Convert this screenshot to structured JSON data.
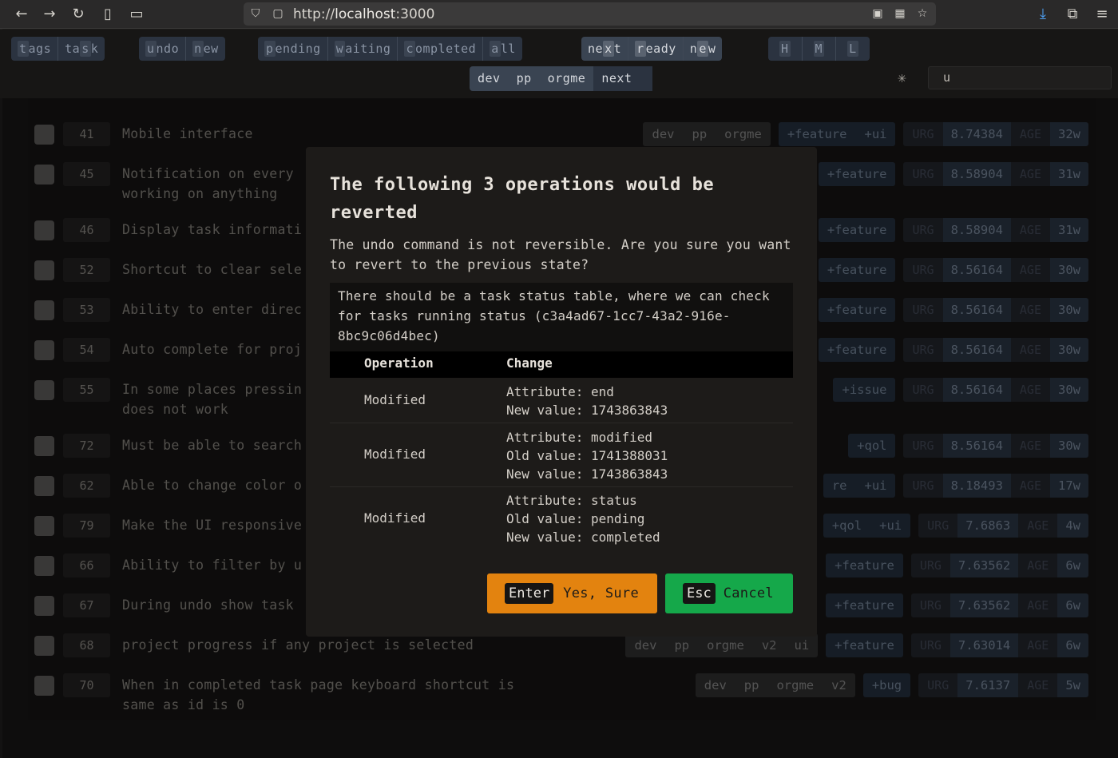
{
  "browser": {
    "url_prefix": "http://",
    "url_host": "localhost",
    "url_port": ":3000"
  },
  "toolbar": {
    "groups": [
      {
        "segments": [
          {
            "pre": "",
            "key": "t",
            "post": "ags"
          },
          {
            "pre": "ta",
            "key": "s",
            "post": "k"
          }
        ]
      },
      {
        "segments": [
          {
            "pre": "",
            "key": "u",
            "post": "ndo"
          },
          {
            "pre": "",
            "key": "n",
            "post": "ew"
          }
        ]
      },
      {
        "segments": [
          {
            "pre": "",
            "key": "p",
            "post": "ending"
          },
          {
            "pre": "",
            "key": "w",
            "post": "aiting"
          },
          {
            "pre": "",
            "key": "c",
            "post": "ompleted"
          },
          {
            "pre": "",
            "key": "a",
            "post": "ll"
          }
        ]
      },
      {
        "segments": [
          {
            "pre": "ne",
            "key": "x",
            "post": "t"
          },
          {
            "pre": "",
            "key": "r",
            "post": "eady"
          },
          {
            "pre": "n",
            "key": "e",
            "post": "w"
          }
        ]
      },
      {
        "segments": [
          {
            "pre": "",
            "key": "H",
            "post": ""
          },
          {
            "pre": "",
            "key": "M",
            "post": ""
          },
          {
            "pre": "",
            "key": "L",
            "post": ""
          }
        ]
      }
    ],
    "search_value": "u",
    "star_symbol": "✳",
    "project_path": [
      "dev",
      "pp",
      "orgme"
    ],
    "project_next": "next"
  },
  "tasks": [
    {
      "id": "41",
      "desc": "Mobile interface",
      "project": [
        "dev",
        "pp",
        "orgme"
      ],
      "tags": [
        "+feature",
        "+ui"
      ],
      "urg_label": "URG",
      "urg": "8.74384",
      "age_label": "AGE",
      "age": "32w"
    },
    {
      "id": "45",
      "desc": "Notification on every\nworking on anything",
      "project": [],
      "tags": [
        "+feature"
      ],
      "urg_label": "URG",
      "urg": "8.58904",
      "age_label": "AGE",
      "age": "31w"
    },
    {
      "id": "46",
      "desc": "Display task informati",
      "project": [],
      "tags": [
        "+feature"
      ],
      "urg_label": "URG",
      "urg": "8.58904",
      "age_label": "AGE",
      "age": "31w"
    },
    {
      "id": "52",
      "desc": "Shortcut to clear sele",
      "project": [],
      "tags": [
        "+feature"
      ],
      "urg_label": "URG",
      "urg": "8.56164",
      "age_label": "AGE",
      "age": "30w"
    },
    {
      "id": "53",
      "desc": "Ability to enter direc",
      "project": [],
      "tags": [
        "+feature"
      ],
      "urg_label": "URG",
      "urg": "8.56164",
      "age_label": "AGE",
      "age": "30w"
    },
    {
      "id": "54",
      "desc": "Auto complete for proj",
      "project": [],
      "tags": [
        "+feature"
      ],
      "urg_label": "URG",
      "urg": "8.56164",
      "age_label": "AGE",
      "age": "30w"
    },
    {
      "id": "55",
      "desc": "In some places pressin\ndoes not work",
      "project": [],
      "tags": [
        "+issue"
      ],
      "urg_label": "URG",
      "urg": "8.56164",
      "age_label": "AGE",
      "age": "30w"
    },
    {
      "id": "72",
      "desc": "Must be able to search",
      "project": [],
      "tags": [
        "+qol"
      ],
      "urg_label": "URG",
      "urg": "8.56164",
      "age_label": "AGE",
      "age": "30w"
    },
    {
      "id": "62",
      "desc": "Able to change color o",
      "project": [],
      "tags": [
        "re",
        "+ui"
      ],
      "urg_label": "URG",
      "urg": "8.18493",
      "age_label": "AGE",
      "age": "17w"
    },
    {
      "id": "79",
      "desc": "Make the UI responsive",
      "project": [],
      "tags": [
        "+qol",
        "+ui"
      ],
      "urg_label": "URG",
      "urg": "7.6863",
      "age_label": "AGE",
      "age": "4w"
    },
    {
      "id": "66",
      "desc": "Ability to filter by u",
      "project": [],
      "tags": [
        "+feature"
      ],
      "urg_label": "URG",
      "urg": "7.63562",
      "age_label": "AGE",
      "age": "6w"
    },
    {
      "id": "67",
      "desc": "During undo show task",
      "project": [],
      "tags": [
        "+feature"
      ],
      "urg_label": "URG",
      "urg": "7.63562",
      "age_label": "AGE",
      "age": "6w"
    },
    {
      "id": "68",
      "desc": "project progress if any project is selected",
      "project": [
        "dev",
        "pp",
        "orgme",
        "v2",
        "ui"
      ],
      "tags": [
        "+feature"
      ],
      "urg_label": "URG",
      "urg": "7.63014",
      "age_label": "AGE",
      "age": "6w"
    },
    {
      "id": "70",
      "desc": "When in completed task page keyboard shortcut is\nsame as id is 0",
      "project": [
        "dev",
        "pp",
        "orgme",
        "v2"
      ],
      "tags": [
        "+bug"
      ],
      "urg_label": "URG",
      "urg": "7.6137",
      "age_label": "AGE",
      "age": "5w"
    }
  ],
  "modal": {
    "title": "The following 3 operations would be reverted",
    "text": "The undo command is not reversible. Are you sure you want to revert to the previous state?",
    "task_description": "There should be a task status table, where we can check for tasks running status (c3a4ad67-1cc7-43a2-916e-8bc9c06d4bec)",
    "col_operation": "Operation",
    "col_change": "Change",
    "operations": [
      {
        "op": "Modified",
        "change": "Attribute: end\nNew value: 1743863843"
      },
      {
        "op": "Modified",
        "change": "Attribute: modified\nOld value: 1741388031\nNew value: 1743863843"
      },
      {
        "op": "Modified",
        "change": "Attribute: status\nOld value: pending\nNew value: completed"
      }
    ],
    "confirm_key": "Enter",
    "confirm_label": "Yes, Sure",
    "cancel_key": "Esc",
    "cancel_label": "Cancel"
  }
}
